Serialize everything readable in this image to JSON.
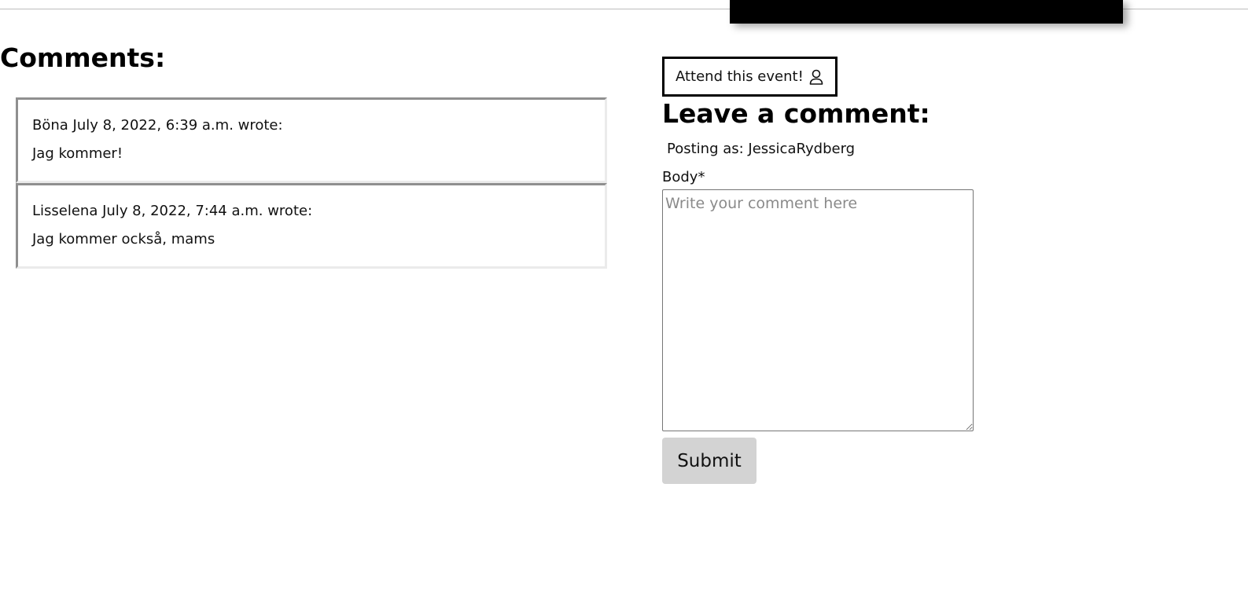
{
  "comments_section": {
    "heading": "Comments:",
    "items": [
      {
        "meta": "Böna July 8, 2022, 6:39 a.m. wrote:",
        "body": "Jag kommer!"
      },
      {
        "meta": "Lisselena July 8, 2022, 7:44 a.m. wrote:",
        "body": "Jag kommer också, mams"
      }
    ]
  },
  "attend": {
    "label": "Attend this event!",
    "icon": "user-icon"
  },
  "comment_form": {
    "heading": "Leave a comment:",
    "posting_as": "Posting as: JessicaRydberg",
    "body_label": "Body*",
    "placeholder": "Write your comment here",
    "submit_label": "Submit"
  },
  "colors": {
    "hero_image": "#000000",
    "submit_bg": "#d3d3d3",
    "comment_border_dark": "#8f8f8f",
    "comment_border_light": "#ebebeb"
  }
}
